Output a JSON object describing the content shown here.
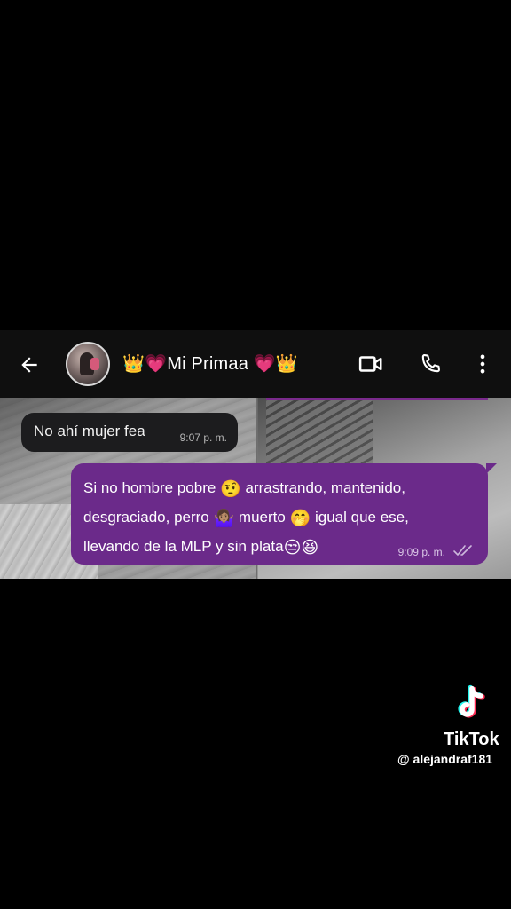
{
  "header": {
    "contact_name": "👑💗Mi Primaa 💗👑",
    "back_icon": "arrow-left-icon",
    "video_icon": "video-camera-icon",
    "call_icon": "phone-icon",
    "menu_icon": "more-vertical-icon",
    "background_color": "#0f0f0f"
  },
  "messages": {
    "incoming": {
      "text": "No ahí mujer fea",
      "time": "9:07 p. m.",
      "bubble_color": "#1c1c1e"
    },
    "outgoing": {
      "line1_a": "Si no hombre pobre",
      "line1_emoji": "🤨",
      "line1_b": "arrastrando, mantenido,",
      "line2_a": "desgraciado, perro",
      "line2_emoji": "🤷🏽‍♀️",
      "line2_b": "muerto",
      "line2_emoji2": "🤭",
      "line2_c": "igual que ese,",
      "line3_a": "llevando de la MLP y sin plata",
      "line3_emoji": "😒😆",
      "time": "9:09 p. m.",
      "read_status_icon": "double-check-icon",
      "bubble_color": "#6b2a8a"
    }
  },
  "watermark": {
    "brand": "TikTok",
    "username": "@ alejandraf181",
    "logo_icon": "tiktok-note-icon"
  }
}
